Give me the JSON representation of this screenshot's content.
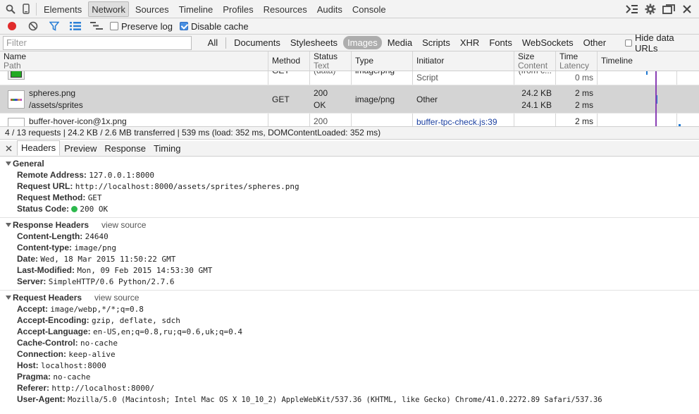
{
  "topbar": {
    "tabs": [
      "Elements",
      "Network",
      "Sources",
      "Timeline",
      "Profiles",
      "Resources",
      "Audits",
      "Console"
    ],
    "active_tab": "Network"
  },
  "toolbar2": {
    "preserve_log_label": "Preserve log",
    "preserve_log_checked": false,
    "disable_cache_label": "Disable cache",
    "disable_cache_checked": true
  },
  "filter": {
    "placeholder": "Filter",
    "types": [
      "All",
      "Documents",
      "Stylesheets",
      "Images",
      "Media",
      "Scripts",
      "XHR",
      "Fonts",
      "WebSockets",
      "Other"
    ],
    "active_type": "Images",
    "hide_data_urls_label": "Hide data URLs"
  },
  "table": {
    "headers": {
      "name": "Name",
      "path": "Path",
      "method": "Method",
      "status": "Status",
      "text": "Text",
      "type": "Type",
      "initiator": "Initiator",
      "size": "Size",
      "content": "Content",
      "time": "Time",
      "latency": "Latency",
      "timeline": "Timeline"
    },
    "rows": [
      {
        "name": "",
        "path": "",
        "method": "GET",
        "status": "",
        "text": "(data)",
        "type": "image/png",
        "initiator": "",
        "initiator_sub": "Script",
        "size": "",
        "content": "(from c...",
        "time": "",
        "latency": "0 ms"
      },
      {
        "name": "spheres.png",
        "path": "/assets/sprites",
        "method": "GET",
        "status": "200",
        "text": "OK",
        "type": "image/png",
        "initiator": "Other",
        "initiator_sub": "",
        "size": "24.2 KB",
        "content": "24.1 KB",
        "time": "2 ms",
        "latency": "2 ms"
      },
      {
        "name": "buffer-hover-icon@1x.png",
        "path": "",
        "method": "",
        "status": "200",
        "text": "",
        "type": "",
        "initiator": "buffer-tpc-check.js:39",
        "initiator_sub": "",
        "size": "",
        "content": "",
        "time": "2 ms",
        "latency": ""
      }
    ]
  },
  "statusbar": {
    "text": "4 / 13 requests | 24.2 KB / 2.6 MB transferred | 539 ms (load: 352 ms, DOMContentLoaded: 352 ms)"
  },
  "detail_tabs": [
    "Headers",
    "Preview",
    "Response",
    "Timing"
  ],
  "detail_active": "Headers",
  "general": {
    "title": "General",
    "items": [
      {
        "k": "Remote Address:",
        "v": "127.0.0.1:8000"
      },
      {
        "k": "Request URL:",
        "v": "http://localhost:8000/assets/sprites/spheres.png"
      },
      {
        "k": "Request Method:",
        "v": "GET"
      },
      {
        "k": "Status Code:",
        "v": "200 OK"
      }
    ]
  },
  "response_headers": {
    "title": "Response Headers",
    "view_source": "view source",
    "items": [
      {
        "k": "Content-Length:",
        "v": "24640"
      },
      {
        "k": "Content-type:",
        "v": "image/png"
      },
      {
        "k": "Date:",
        "v": "Wed, 18 Mar 2015 11:50:22 GMT"
      },
      {
        "k": "Last-Modified:",
        "v": "Mon, 09 Feb 2015 14:53:30 GMT"
      },
      {
        "k": "Server:",
        "v": "SimpleHTTP/0.6 Python/2.7.6"
      }
    ]
  },
  "request_headers": {
    "title": "Request Headers",
    "view_source": "view source",
    "items": [
      {
        "k": "Accept:",
        "v": "image/webp,*/*;q=0.8"
      },
      {
        "k": "Accept-Encoding:",
        "v": "gzip, deflate, sdch"
      },
      {
        "k": "Accept-Language:",
        "v": "en-US,en;q=0.8,ru;q=0.6,uk;q=0.4"
      },
      {
        "k": "Cache-Control:",
        "v": "no-cache"
      },
      {
        "k": "Connection:",
        "v": "keep-alive"
      },
      {
        "k": "Host:",
        "v": "localhost:8000"
      },
      {
        "k": "Pragma:",
        "v": "no-cache"
      },
      {
        "k": "Referer:",
        "v": "http://localhost:8000/"
      },
      {
        "k": "User-Agent:",
        "v": "Mozilla/5.0 (Macintosh; Intel Mac OS X 10_10_2) AppleWebKit/537.36 (KHTML, like Gecko) Chrome/41.0.2272.89 Safari/537.36"
      }
    ]
  },
  "colors": {
    "record": "#e02b2b",
    "accent": "#4a90e2",
    "status_ok": "#2db84d",
    "timeline_purple": "#8a3fb5",
    "timeline_blue": "#1f78d1"
  }
}
